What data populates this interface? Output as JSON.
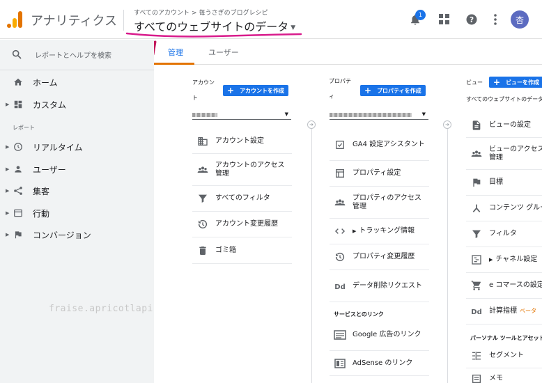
{
  "header": {
    "app_title": "アナリティクス",
    "breadcrumb": [
      "すべてのアカウント",
      "毎うさぎのブログレシピ"
    ],
    "breadcrumb_sep": ">",
    "view_title": "すべてのウェブサイトのデータ",
    "notification_count": "1",
    "avatar_initial": "杏"
  },
  "sidebar": {
    "search_placeholder": "レポートとヘルプを検索",
    "top_items": [
      {
        "label": "ホーム",
        "icon": "home-icon"
      },
      {
        "label": "カスタム",
        "icon": "dashboard-icon"
      }
    ],
    "section_label": "レポート",
    "report_items": [
      {
        "label": "リアルタイム",
        "icon": "clock-icon"
      },
      {
        "label": "ユーザー",
        "icon": "person-icon"
      },
      {
        "label": "集客",
        "icon": "acquisition-icon"
      },
      {
        "label": "行動",
        "icon": "behavior-icon"
      },
      {
        "label": "コンバージョン",
        "icon": "flag-icon"
      }
    ],
    "watermark": "fraise.apricotlapin.com"
  },
  "tabs": [
    {
      "label": "管理",
      "active": true
    },
    {
      "label": "ユーザー",
      "active": false
    }
  ],
  "account_col": {
    "label_top": "アカウン",
    "label_bottom": "ト",
    "create_button": "アカウントを作成",
    "items": [
      {
        "label": "アカウント設定",
        "icon": "building-icon"
      },
      {
        "label": "アカウントのアクセス管理",
        "icon": "people-icon"
      },
      {
        "label": "すべてのフィルタ",
        "icon": "filter-icon"
      },
      {
        "label": "アカウント変更履歴",
        "icon": "history-icon"
      },
      {
        "label": "ゴミ箱",
        "icon": "trash-icon"
      }
    ]
  },
  "property_col": {
    "label_top": "プロパテ",
    "label_bottom": "ィ",
    "create_button": "プロパティを作成",
    "items": [
      {
        "label": "GA4 設定アシスタント",
        "icon": "checkbox-icon"
      },
      {
        "label": "プロパティ設定",
        "icon": "window-icon"
      },
      {
        "label": "プロパティのアクセス管理",
        "icon": "people-icon"
      },
      {
        "label": "トラッキング情報",
        "icon": "code-icon"
      },
      {
        "label": "プロパティ変更履歴",
        "icon": "history-icon"
      },
      {
        "label": "データ削除リクエスト",
        "icon": "dd-icon"
      }
    ],
    "links_heading": "サービスとのリンク",
    "link_items": [
      {
        "label": "Google 広告のリンク",
        "icon": "ads-icon"
      },
      {
        "label": "AdSense のリンク",
        "icon": "adsense-icon"
      }
    ]
  },
  "view_col": {
    "label": "ビュー",
    "create_button": "ビューを作成",
    "selected_view": "すべてのウェブサイトのデータ",
    "items": [
      {
        "label": "ビューの設定",
        "icon": "document-icon"
      },
      {
        "label": "ビューのアクセス管理",
        "icon": "people-icon"
      },
      {
        "label": "目標",
        "icon": "flag-icon"
      },
      {
        "label": "コンテンツ グループ",
        "icon": "grouping-icon"
      },
      {
        "label": "フィルタ",
        "icon": "filter-icon"
      },
      {
        "label": "チャネル設定",
        "icon": "channel-icon"
      },
      {
        "label": "e コマースの設定",
        "icon": "cart-icon"
      },
      {
        "label": "計算指標",
        "beta": "ベータ",
        "icon": "dd-icon"
      }
    ],
    "personal_heading": "パーソナル ツールとアセット",
    "personal_items": [
      {
        "label": "セグメント",
        "icon": "segment-icon"
      },
      {
        "label": "メモ",
        "icon": "note-icon"
      }
    ]
  },
  "colors": {
    "accent_blue": "#1a73e8",
    "accent_orange": "#e37400",
    "annotation_magenta": "#d81b8c",
    "sidebar_bg": "#f1f3f4"
  }
}
